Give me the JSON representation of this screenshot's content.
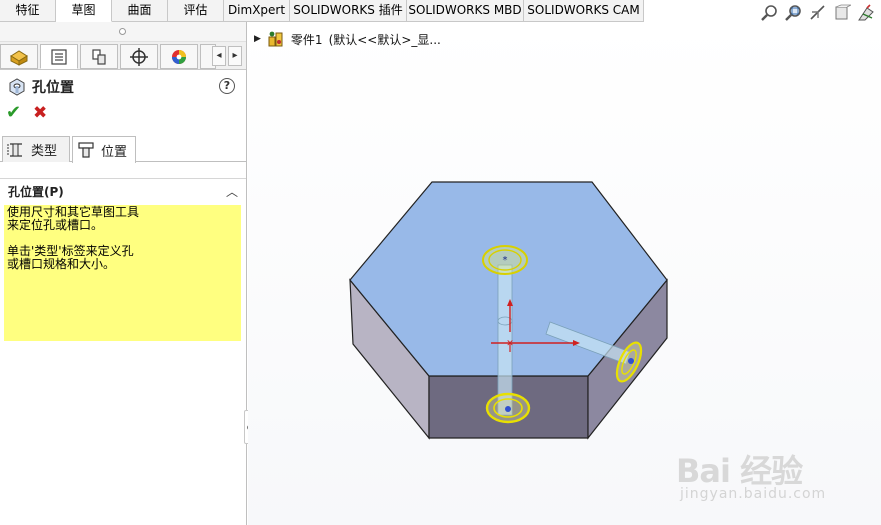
{
  "command_tabs": [
    {
      "label": "特征",
      "active": false
    },
    {
      "label": "草图",
      "active": true
    },
    {
      "label": "曲面",
      "active": false
    },
    {
      "label": "评估",
      "active": false
    },
    {
      "label": "DimXpert",
      "active": false
    },
    {
      "label": "SOLIDWORKS 插件",
      "active": false
    },
    {
      "label": "SOLIDWORKS MBD",
      "active": false
    },
    {
      "label": "SOLIDWORKS CAM",
      "active": false
    }
  ],
  "view_toolbar_icons": [
    "zoom-to-fit-icon",
    "zoom-to-area-icon",
    "previous-view-icon",
    "section-view-icon",
    "view-orientation-icon"
  ],
  "manager_tabs": [
    "featuremanager-icon",
    "propertymanager-icon",
    "configurationmanager-icon",
    "dimxpertmanager-icon",
    "display-manager-icon"
  ],
  "property_manager": {
    "title": "孔位置",
    "help": "?",
    "ok": "✔",
    "cancel": "✖",
    "sub_tabs": [
      {
        "label": "类型",
        "active": false
      },
      {
        "label": "位置",
        "active": true
      }
    ],
    "group": {
      "title": "孔位置(P)",
      "hint_lines_1": [
        "使用尺寸和其它草图工具",
        "来定位孔或槽口。"
      ],
      "hint_lines_2": [
        "单击'类型'标签来定义孔",
        "或槽口规格和大小。"
      ]
    }
  },
  "graphics": {
    "tree_label": "零件1",
    "tree_config": "(默认<<默认>_显..."
  },
  "watermark": {
    "logo": "Bai 经验",
    "url": "jingyan.baidu.com"
  },
  "colors": {
    "model_top": "#8fb3e6",
    "model_side": "#b8b4c8",
    "hole_highlight": "#e8e000",
    "hint_background": "#ffff80"
  }
}
